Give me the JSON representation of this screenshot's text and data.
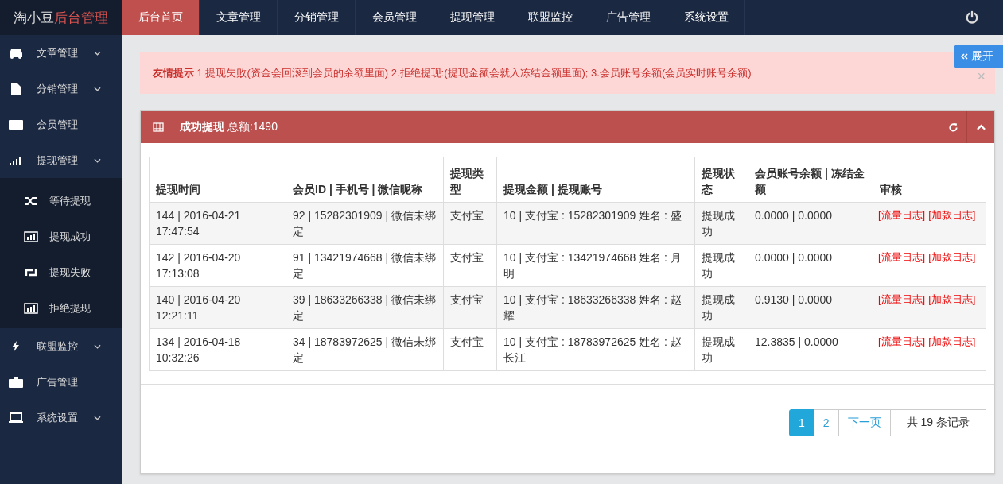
{
  "logo": {
    "part_1": "淘小豆",
    "part_2": "后台管理"
  },
  "top_nav": [
    {
      "label": "后台首页",
      "selected": true
    },
    {
      "label": "文章管理",
      "selected": false
    },
    {
      "label": "分销管理",
      "selected": false
    },
    {
      "label": "会员管理",
      "selected": false
    },
    {
      "label": "提现管理",
      "selected": false
    },
    {
      "label": "联盟监控",
      "selected": false
    },
    {
      "label": "广告管理",
      "selected": false
    },
    {
      "label": "系统设置",
      "selected": false
    }
  ],
  "sidebar": {
    "items": [
      {
        "label": "文章管理",
        "has_caret": true,
        "expanded": false
      },
      {
        "label": "分销管理",
        "has_caret": true,
        "expanded": false
      },
      {
        "label": "会员管理",
        "has_caret": false
      },
      {
        "label": "提现管理",
        "has_caret": true,
        "expanded": true,
        "children": [
          {
            "label": "等待提现"
          },
          {
            "label": "提现成功"
          },
          {
            "label": "提现失败"
          },
          {
            "label": "拒绝提现"
          }
        ]
      },
      {
        "label": "联盟监控",
        "has_caret": true,
        "expanded": false
      },
      {
        "label": "广告管理",
        "has_caret": false
      },
      {
        "label": "系统设置",
        "has_caret": true,
        "expanded": false
      }
    ]
  },
  "expand_tab": {
    "label": "展开"
  },
  "alert": {
    "title": "友情提示",
    "text": "1.提现失败(资金会回滚到会员的余额里面) 2.拒绝提现:(提现金额会就入冻结金额里面); 3.会员账号余额(会员实时账号余额)",
    "close": "×"
  },
  "panel": {
    "title": "成功提现",
    "subtitle": "总额:1490",
    "table": {
      "columns": [
        "提现时间",
        "会员ID | 手机号 | 微信昵称",
        "提现类型",
        "提现金额 | 提现账号",
        "提现状态",
        "会员账号余额 | 冻结金额",
        "审核"
      ],
      "rows": [
        {
          "cells": [
            "144 | 2016-04-21 17:47:54",
            "92 | 15282301909 | 微信未绑定",
            "支付宝",
            "10 | 支付宝 : 15282301909 姓名 : 盛",
            "提现成功",
            "0.0000 | 0.0000"
          ],
          "links": [
            "[流量日志]",
            "[加款日志]"
          ]
        },
        {
          "cells": [
            "142 | 2016-04-20 17:13:08",
            "91 | 13421974668 | 微信未绑定",
            "支付宝",
            "10 | 支付宝 : 13421974668 姓名 : 月明",
            "提现成功",
            "0.0000 | 0.0000"
          ],
          "links": [
            "[流量日志]",
            "[加款日志]"
          ]
        },
        {
          "cells": [
            "140 | 2016-04-20 12:21:11",
            "39 | 18633266338 | 微信未绑定",
            "支付宝",
            "10 | 支付宝 : 18633266338 姓名 : 赵耀",
            "提现成功",
            "0.9130 | 0.0000"
          ],
          "links": [
            "[流量日志]",
            "[加款日志]"
          ]
        },
        {
          "cells": [
            "134 | 2016-04-18 10:32:26",
            "34 | 18783972625 | 微信未绑定",
            "支付宝",
            "10 | 支付宝 : 18783972625 姓名 : 赵长江",
            "提现成功",
            "12.3835 | 0.0000"
          ],
          "links": [
            "[流量日志]",
            "[加款日志]"
          ]
        }
      ]
    },
    "pagination": {
      "pages": [
        {
          "label": "1",
          "selected": true
        },
        {
          "label": "2",
          "selected": false
        }
      ],
      "next": "下一页",
      "total": "共 19 条记录"
    }
  }
}
